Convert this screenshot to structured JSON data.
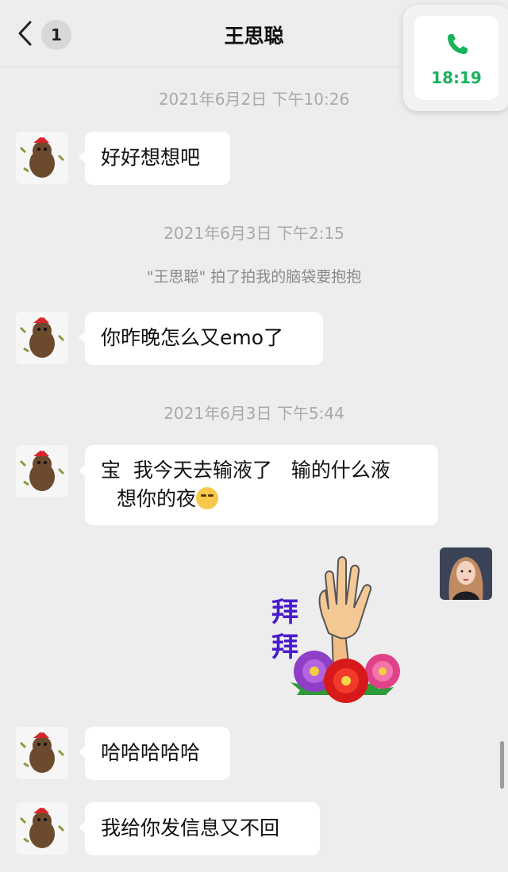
{
  "header": {
    "title": "王思聪",
    "unread_count": "1",
    "back_icon": "chevron-left-icon"
  },
  "call_widget": {
    "time": "18:19",
    "icon": "phone-icon",
    "accent_color": "#19b35a"
  },
  "messages": [
    {
      "type": "timestamp",
      "text": "2021年6月2日 下午10:26"
    },
    {
      "type": "bubble",
      "sender": "other",
      "text": "好好想想吧"
    },
    {
      "type": "timestamp",
      "text": "2021年6月3日 下午2:15"
    },
    {
      "type": "system",
      "text": "\"王思聪\" 拍了拍我的脑袋要抱抱"
    },
    {
      "type": "bubble",
      "sender": "other",
      "text": "你昨晚怎么又emo了"
    },
    {
      "type": "timestamp",
      "text": "2021年6月3日 下午5:44"
    },
    {
      "type": "bubble",
      "sender": "other",
      "text_line1": "宝  我今天去输液了   输的什么液",
      "text_line2": "想你的夜"
    },
    {
      "type": "sticker",
      "sender": "self",
      "text_line1": "拜",
      "text_line2": "拜"
    },
    {
      "type": "bubble",
      "sender": "other",
      "text": "哈哈哈哈哈"
    },
    {
      "type": "bubble",
      "sender": "other",
      "text": "我给你发信息又不回"
    }
  ],
  "colors": {
    "background": "#ededed",
    "bubble": "#ffffff",
    "timestamp": "#a9a9a9"
  }
}
